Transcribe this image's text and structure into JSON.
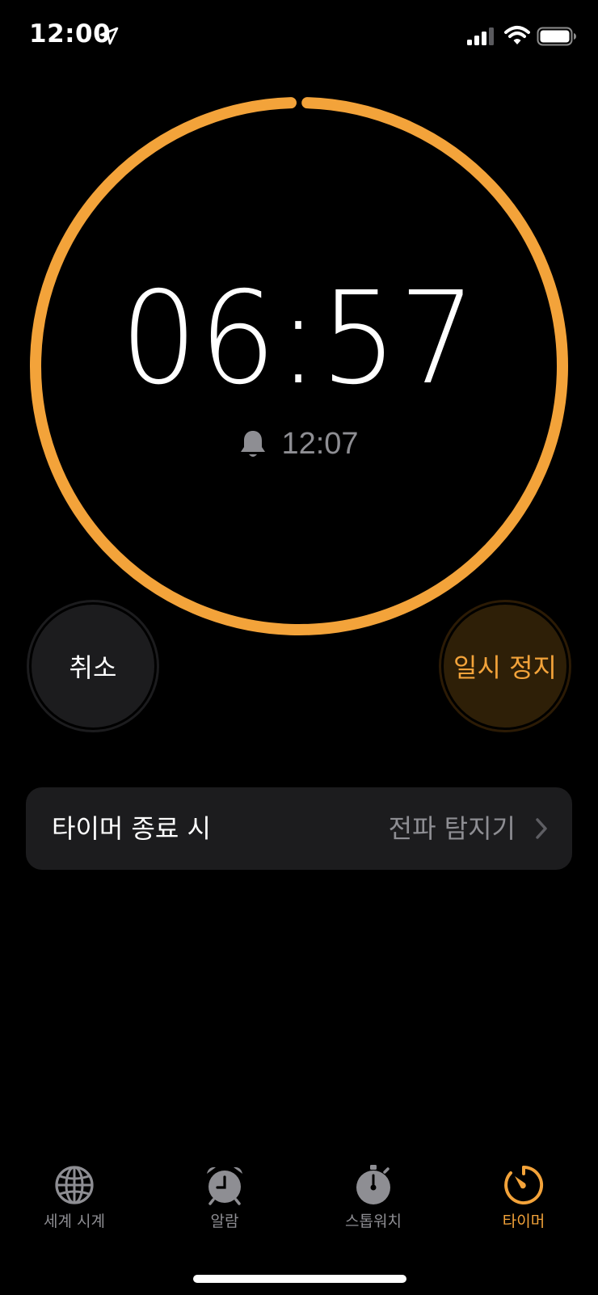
{
  "status_bar": {
    "time": "12:00",
    "icons": [
      "location-arrow-icon",
      "cellular-signal-icon",
      "wifi-icon",
      "battery-icon"
    ]
  },
  "timer": {
    "remaining": "06:57",
    "end_time": "12:07",
    "progress_remaining": 0.99,
    "ring_color": "#F3A33A"
  },
  "buttons": {
    "cancel_label": "취소",
    "pause_label": "일시 정지"
  },
  "when_timer_ends": {
    "label": "타이머 종료 시",
    "value": "전파 탐지기"
  },
  "tabs": [
    {
      "label": "세계 시계",
      "icon": "globe-icon",
      "active": false
    },
    {
      "label": "알람",
      "icon": "alarm-clock-icon",
      "active": false
    },
    {
      "label": "스톱워치",
      "icon": "stopwatch-icon",
      "active": false
    },
    {
      "label": "타이머",
      "icon": "timer-icon",
      "active": true
    }
  ],
  "colors": {
    "accent": "#F3A33A",
    "secondary_text": "#8E8E93",
    "cell_background": "#1C1C1E"
  }
}
